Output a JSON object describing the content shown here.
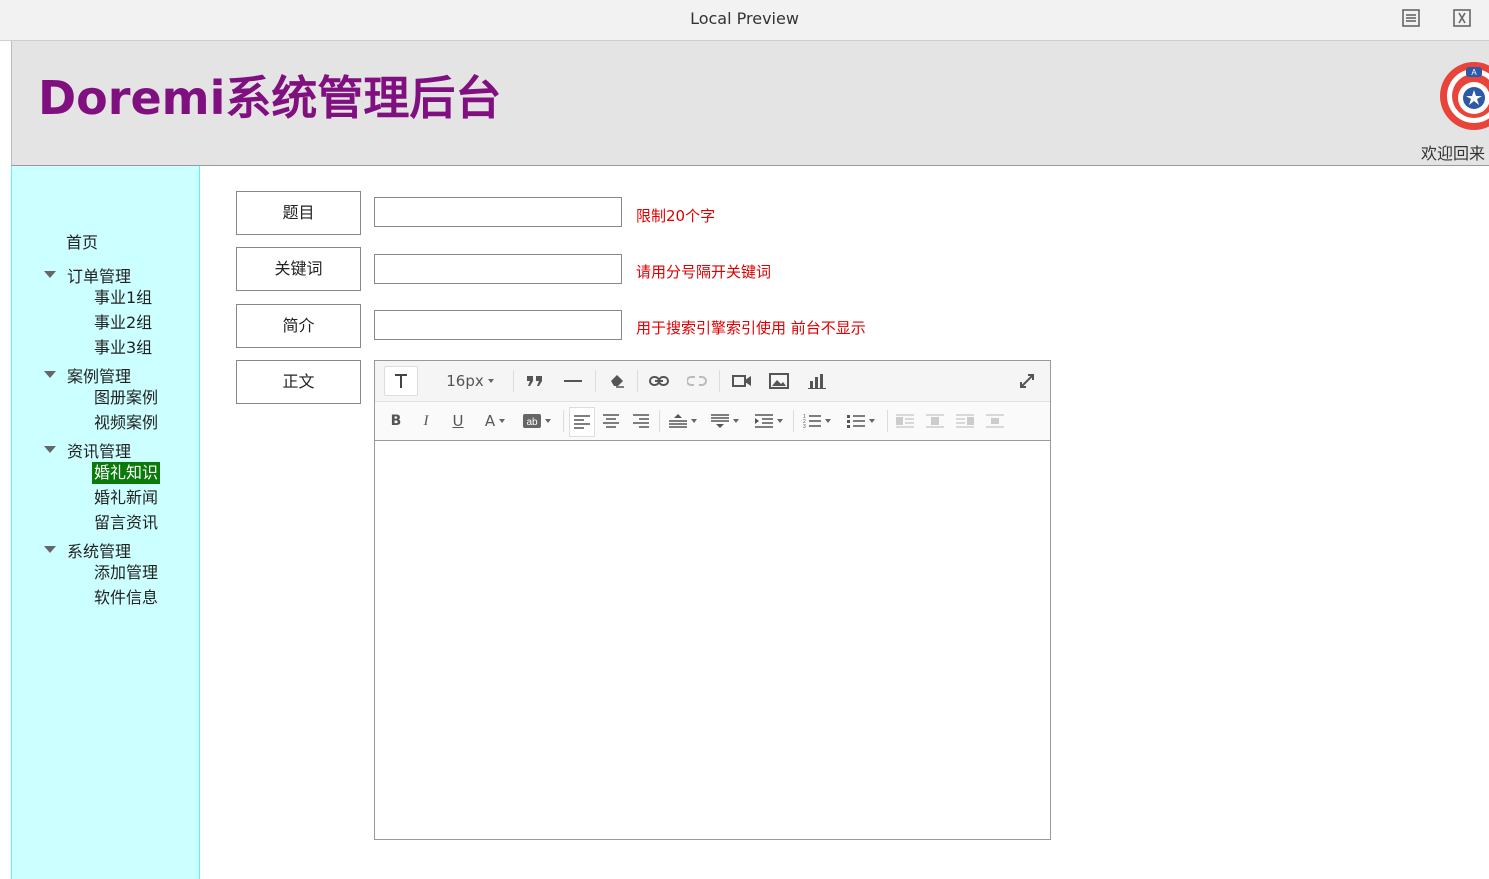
{
  "window": {
    "title": "Local Preview"
  },
  "header": {
    "brand": "Doremi系统管理后台",
    "welcome": "欢迎回来"
  },
  "sidebar": {
    "home": "首页",
    "groups": [
      {
        "label": "订单管理",
        "items": [
          "事业1组",
          "事业2组",
          "事业3组"
        ]
      },
      {
        "label": "案例管理",
        "items": [
          "图册案例",
          "视频案例"
        ]
      },
      {
        "label": "资讯管理",
        "items": [
          "婚礼知识",
          "婚礼新闻",
          "留言资讯"
        ]
      },
      {
        "label": "系统管理",
        "items": [
          "添加管理",
          "软件信息"
        ]
      }
    ],
    "active_item": "婚礼知识"
  },
  "form": {
    "title": {
      "label": "题目",
      "value": "",
      "hint": "限制20个字"
    },
    "keywords": {
      "label": "关键词",
      "value": "",
      "hint": "请用分号隔开关键词"
    },
    "summary": {
      "label": "简介",
      "value": "",
      "hint": "用于搜索引擎索引使用 前台不显示"
    },
    "body": {
      "label": "正文"
    }
  },
  "editor": {
    "font_size": "16px",
    "content": ""
  },
  "colors": {
    "brand": "#80107f",
    "sidebar_bg": "#ccffff",
    "hint": "#e00000",
    "active_bg": "#0a7a0a"
  }
}
